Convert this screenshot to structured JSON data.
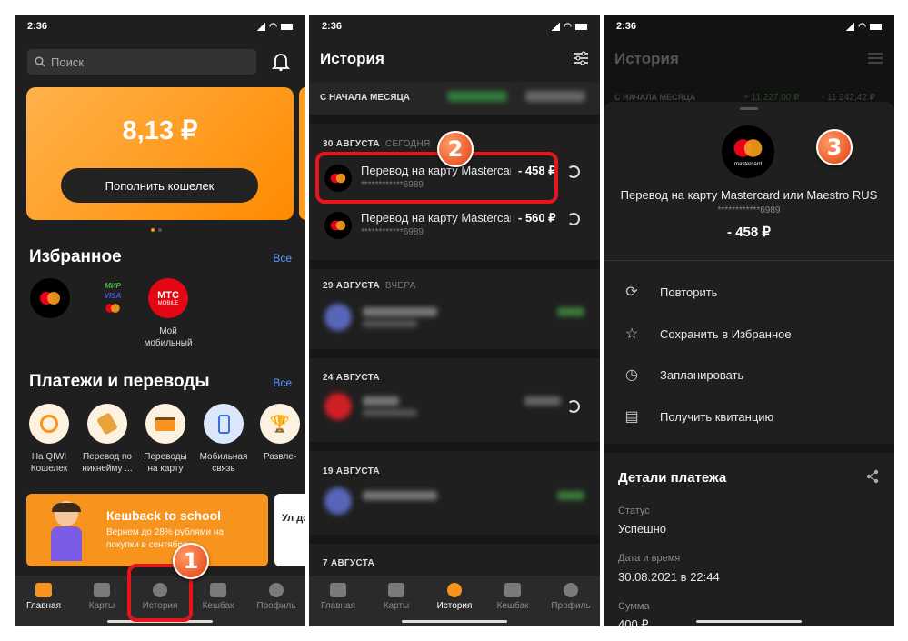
{
  "status": {
    "time": "2:36"
  },
  "home": {
    "search_placeholder": "Поиск",
    "balance": "8,13 ₽",
    "topup": "Пополнить кошелек",
    "favorites_title": "Избранное",
    "all": "Все",
    "favorites": [
      {
        "label": ""
      },
      {
        "label": ""
      },
      {
        "label": "Мой мобильный"
      }
    ],
    "mts_text": "МТС",
    "mts_sub": "MOBILE",
    "payments_title": "Платежи и переводы",
    "payments": [
      {
        "label": "На QIWI Кошелек"
      },
      {
        "label": "Перевод по никнейму ..."
      },
      {
        "label": "Переводы на карту"
      },
      {
        "label": "Мобильная связь"
      },
      {
        "label": "Развлечения"
      }
    ],
    "promo_title": "Кешback to school",
    "promo_text": "Вернем до 28% рублями на покупки в сентябре",
    "promo2": "Ул до"
  },
  "nav": [
    "Главная",
    "Карты",
    "История",
    "Кешбак",
    "Профиль"
  ],
  "history": {
    "title": "История",
    "period": "С НАЧАЛА МЕСЯЦА",
    "groups": [
      {
        "date": "30 АВГУСТА",
        "sub": "СЕГОДНЯ"
      },
      {
        "date": "29 АВГУСТА",
        "sub": "ВЧЕРА"
      },
      {
        "date": "24 АВГУСТА",
        "sub": ""
      },
      {
        "date": "19 АВГУСТА",
        "sub": ""
      },
      {
        "date": "7 АВГУСТА",
        "sub": ""
      }
    ],
    "rows": [
      {
        "name": "Перевод на карту Mastercard или Maestro RUS",
        "card": "************6989",
        "amount": "- 458 ₽"
      },
      {
        "name": "Перевод на карту Mastercard или Maestro RUS",
        "card": "************6989",
        "amount": "- 560 ₽"
      }
    ]
  },
  "details": {
    "bg_title": "История",
    "bg_period": "С НАЧАЛА МЕСЯЦА",
    "bg_plus": "+ 11 227,00 ₽",
    "bg_minus": "- 11 242,42 ₽",
    "mc_text": "mastercard",
    "name": "Перевод на карту Mastercard или Maestro RUS",
    "card": "************6989",
    "amount": "- 458 ₽",
    "actions": [
      {
        "icon": "repeat-icon",
        "label": "Повторить"
      },
      {
        "icon": "star-icon",
        "label": "Сохранить в Избранное"
      },
      {
        "icon": "clock-icon",
        "label": "Запланировать"
      },
      {
        "icon": "receipt-icon",
        "label": "Получить квитанцию"
      }
    ],
    "section": "Детали платежа",
    "fields": [
      {
        "label": "Статус",
        "value": "Успешно"
      },
      {
        "label": "Дата и время",
        "value": "30.08.2021 в 22:44"
      },
      {
        "label": "Сумма",
        "value": "400 ₽"
      }
    ]
  },
  "badges": [
    "1",
    "2",
    "3"
  ],
  "colors": {
    "accent": "#f7941d",
    "bg": "#1f1f1f",
    "highlight": "#e8141c"
  }
}
